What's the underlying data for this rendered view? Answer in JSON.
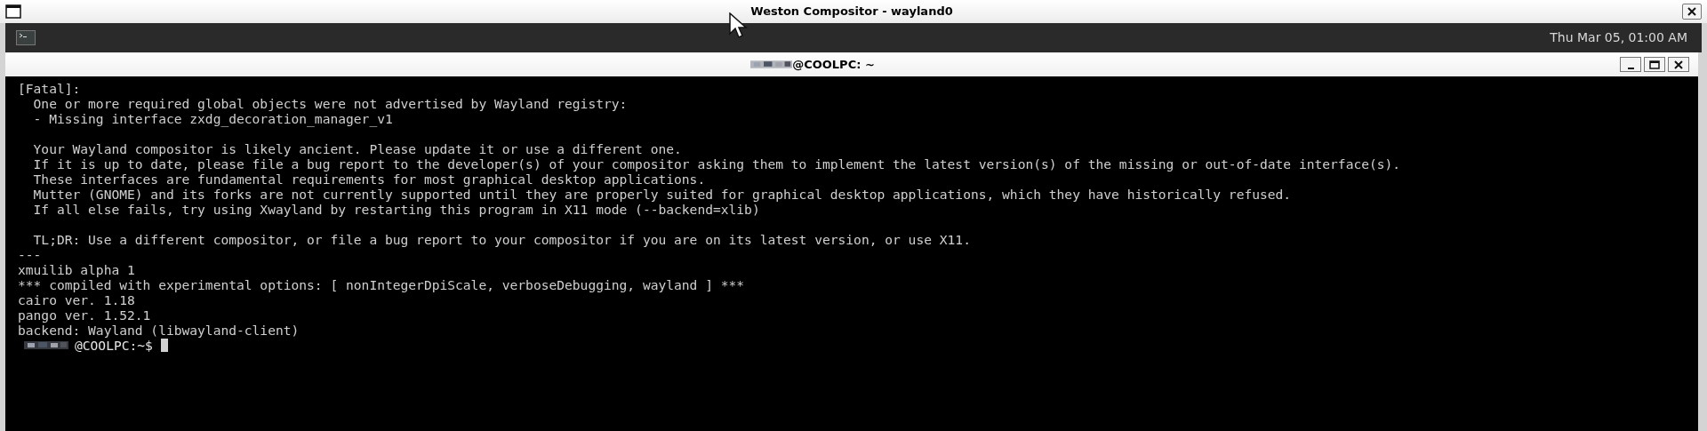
{
  "window": {
    "title": "Weston Compositor - wayland0"
  },
  "panel": {
    "clock": "Thu Mar 05, 01:00 AM"
  },
  "terminal": {
    "title": "@COOLPC: ~",
    "paragraphs": [
      [
        "[Fatal]:",
        "  One or more required global objects were not advertised by Wayland registry:",
        "  - Missing interface zxdg_decoration_manager_v1"
      ],
      [
        "  Your Wayland compositor is likely ancient. Please update it or use a different one.",
        "  If it is up to date, please file a bug report to the developer(s) of your compositor asking them to implement the latest version(s) of the missing or out-of-date interface(s).",
        "  These interfaces are fundamental requirements for most graphical desktop applications.",
        "  Mutter (GNOME) and its forks are not currently supported until they are properly suited for graphical desktop applications, which they have historically refused.",
        "  If all else fails, try using Xwayland by restarting this program in X11 mode (--backend=xlib)"
      ],
      [
        "  TL;DR: Use a different compositor, or file a bug report to your compositor if you are on its latest version, or use X11.",
        "---",
        "xmuilib alpha 1",
        "*** compiled with experimental options: [ nonIntegerDpiScale, verboseDebugging, wayland ] ***",
        "cairo ver. 1.18",
        "pango ver. 1.52.1",
        "backend: Wayland (libwayland-client)"
      ]
    ],
    "prompt": {
      "text": "@COOLPC:~$",
      "cursor": true
    }
  }
}
